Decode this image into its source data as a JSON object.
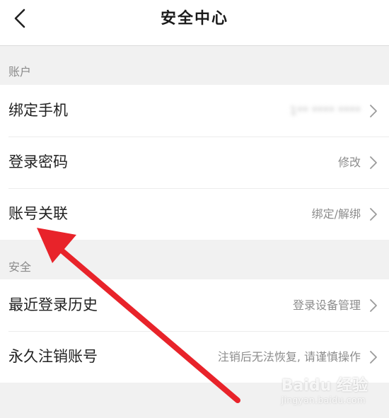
{
  "header": {
    "title": "安全中心",
    "back_icon": "chevron-left-icon"
  },
  "sections": [
    {
      "title": "账户",
      "rows": [
        {
          "label": "绑定手机",
          "value": "1** **** ****",
          "value_blurred": true
        },
        {
          "label": "登录密码",
          "value": "修改"
        },
        {
          "label": "账号关联",
          "value": "绑定/解绑"
        }
      ]
    },
    {
      "title": "安全",
      "rows": [
        {
          "label": "最近登录历史",
          "value": "登录设备管理"
        },
        {
          "label": "永久注销账号",
          "value": "注销后无法恢复, 请谨慎操作"
        }
      ]
    }
  ],
  "watermark": {
    "brand": "Baidu 经验",
    "url": "jingyan.baidu.com"
  },
  "colors": {
    "background": "#f1f1f1",
    "annotation_arrow": "#e8232a"
  }
}
